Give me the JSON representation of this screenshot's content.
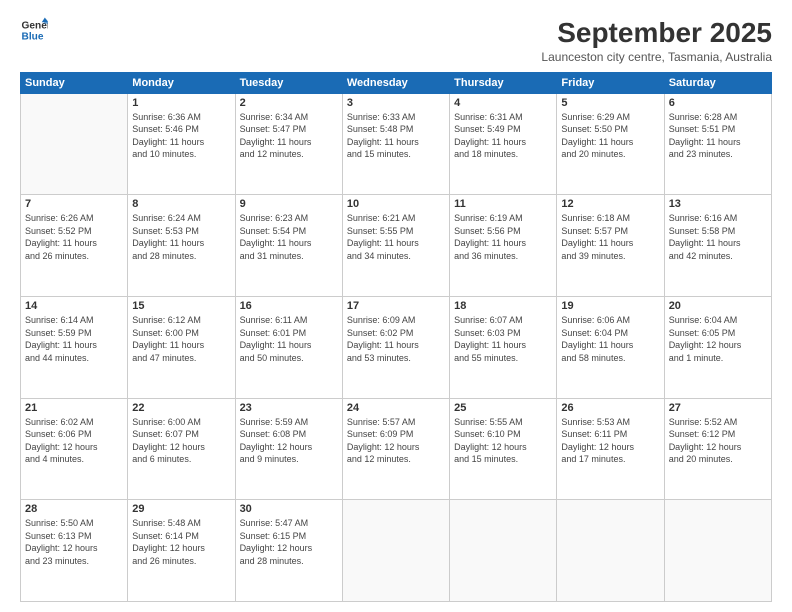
{
  "logo": {
    "line1": "General",
    "line2": "Blue"
  },
  "title": "September 2025",
  "subtitle": "Launceston city centre, Tasmania, Australia",
  "weekdays": [
    "Sunday",
    "Monday",
    "Tuesday",
    "Wednesday",
    "Thursday",
    "Friday",
    "Saturday"
  ],
  "weeks": [
    [
      {
        "day": "",
        "info": ""
      },
      {
        "day": "1",
        "info": "Sunrise: 6:36 AM\nSunset: 5:46 PM\nDaylight: 11 hours\nand 10 minutes."
      },
      {
        "day": "2",
        "info": "Sunrise: 6:34 AM\nSunset: 5:47 PM\nDaylight: 11 hours\nand 12 minutes."
      },
      {
        "day": "3",
        "info": "Sunrise: 6:33 AM\nSunset: 5:48 PM\nDaylight: 11 hours\nand 15 minutes."
      },
      {
        "day": "4",
        "info": "Sunrise: 6:31 AM\nSunset: 5:49 PM\nDaylight: 11 hours\nand 18 minutes."
      },
      {
        "day": "5",
        "info": "Sunrise: 6:29 AM\nSunset: 5:50 PM\nDaylight: 11 hours\nand 20 minutes."
      },
      {
        "day": "6",
        "info": "Sunrise: 6:28 AM\nSunset: 5:51 PM\nDaylight: 11 hours\nand 23 minutes."
      }
    ],
    [
      {
        "day": "7",
        "info": "Sunrise: 6:26 AM\nSunset: 5:52 PM\nDaylight: 11 hours\nand 26 minutes."
      },
      {
        "day": "8",
        "info": "Sunrise: 6:24 AM\nSunset: 5:53 PM\nDaylight: 11 hours\nand 28 minutes."
      },
      {
        "day": "9",
        "info": "Sunrise: 6:23 AM\nSunset: 5:54 PM\nDaylight: 11 hours\nand 31 minutes."
      },
      {
        "day": "10",
        "info": "Sunrise: 6:21 AM\nSunset: 5:55 PM\nDaylight: 11 hours\nand 34 minutes."
      },
      {
        "day": "11",
        "info": "Sunrise: 6:19 AM\nSunset: 5:56 PM\nDaylight: 11 hours\nand 36 minutes."
      },
      {
        "day": "12",
        "info": "Sunrise: 6:18 AM\nSunset: 5:57 PM\nDaylight: 11 hours\nand 39 minutes."
      },
      {
        "day": "13",
        "info": "Sunrise: 6:16 AM\nSunset: 5:58 PM\nDaylight: 11 hours\nand 42 minutes."
      }
    ],
    [
      {
        "day": "14",
        "info": "Sunrise: 6:14 AM\nSunset: 5:59 PM\nDaylight: 11 hours\nand 44 minutes."
      },
      {
        "day": "15",
        "info": "Sunrise: 6:12 AM\nSunset: 6:00 PM\nDaylight: 11 hours\nand 47 minutes."
      },
      {
        "day": "16",
        "info": "Sunrise: 6:11 AM\nSunset: 6:01 PM\nDaylight: 11 hours\nand 50 minutes."
      },
      {
        "day": "17",
        "info": "Sunrise: 6:09 AM\nSunset: 6:02 PM\nDaylight: 11 hours\nand 53 minutes."
      },
      {
        "day": "18",
        "info": "Sunrise: 6:07 AM\nSunset: 6:03 PM\nDaylight: 11 hours\nand 55 minutes."
      },
      {
        "day": "19",
        "info": "Sunrise: 6:06 AM\nSunset: 6:04 PM\nDaylight: 11 hours\nand 58 minutes."
      },
      {
        "day": "20",
        "info": "Sunrise: 6:04 AM\nSunset: 6:05 PM\nDaylight: 12 hours\nand 1 minute."
      }
    ],
    [
      {
        "day": "21",
        "info": "Sunrise: 6:02 AM\nSunset: 6:06 PM\nDaylight: 12 hours\nand 4 minutes."
      },
      {
        "day": "22",
        "info": "Sunrise: 6:00 AM\nSunset: 6:07 PM\nDaylight: 12 hours\nand 6 minutes."
      },
      {
        "day": "23",
        "info": "Sunrise: 5:59 AM\nSunset: 6:08 PM\nDaylight: 12 hours\nand 9 minutes."
      },
      {
        "day": "24",
        "info": "Sunrise: 5:57 AM\nSunset: 6:09 PM\nDaylight: 12 hours\nand 12 minutes."
      },
      {
        "day": "25",
        "info": "Sunrise: 5:55 AM\nSunset: 6:10 PM\nDaylight: 12 hours\nand 15 minutes."
      },
      {
        "day": "26",
        "info": "Sunrise: 5:53 AM\nSunset: 6:11 PM\nDaylight: 12 hours\nand 17 minutes."
      },
      {
        "day": "27",
        "info": "Sunrise: 5:52 AM\nSunset: 6:12 PM\nDaylight: 12 hours\nand 20 minutes."
      }
    ],
    [
      {
        "day": "28",
        "info": "Sunrise: 5:50 AM\nSunset: 6:13 PM\nDaylight: 12 hours\nand 23 minutes."
      },
      {
        "day": "29",
        "info": "Sunrise: 5:48 AM\nSunset: 6:14 PM\nDaylight: 12 hours\nand 26 minutes."
      },
      {
        "day": "30",
        "info": "Sunrise: 5:47 AM\nSunset: 6:15 PM\nDaylight: 12 hours\nand 28 minutes."
      },
      {
        "day": "",
        "info": ""
      },
      {
        "day": "",
        "info": ""
      },
      {
        "day": "",
        "info": ""
      },
      {
        "day": "",
        "info": ""
      }
    ]
  ]
}
